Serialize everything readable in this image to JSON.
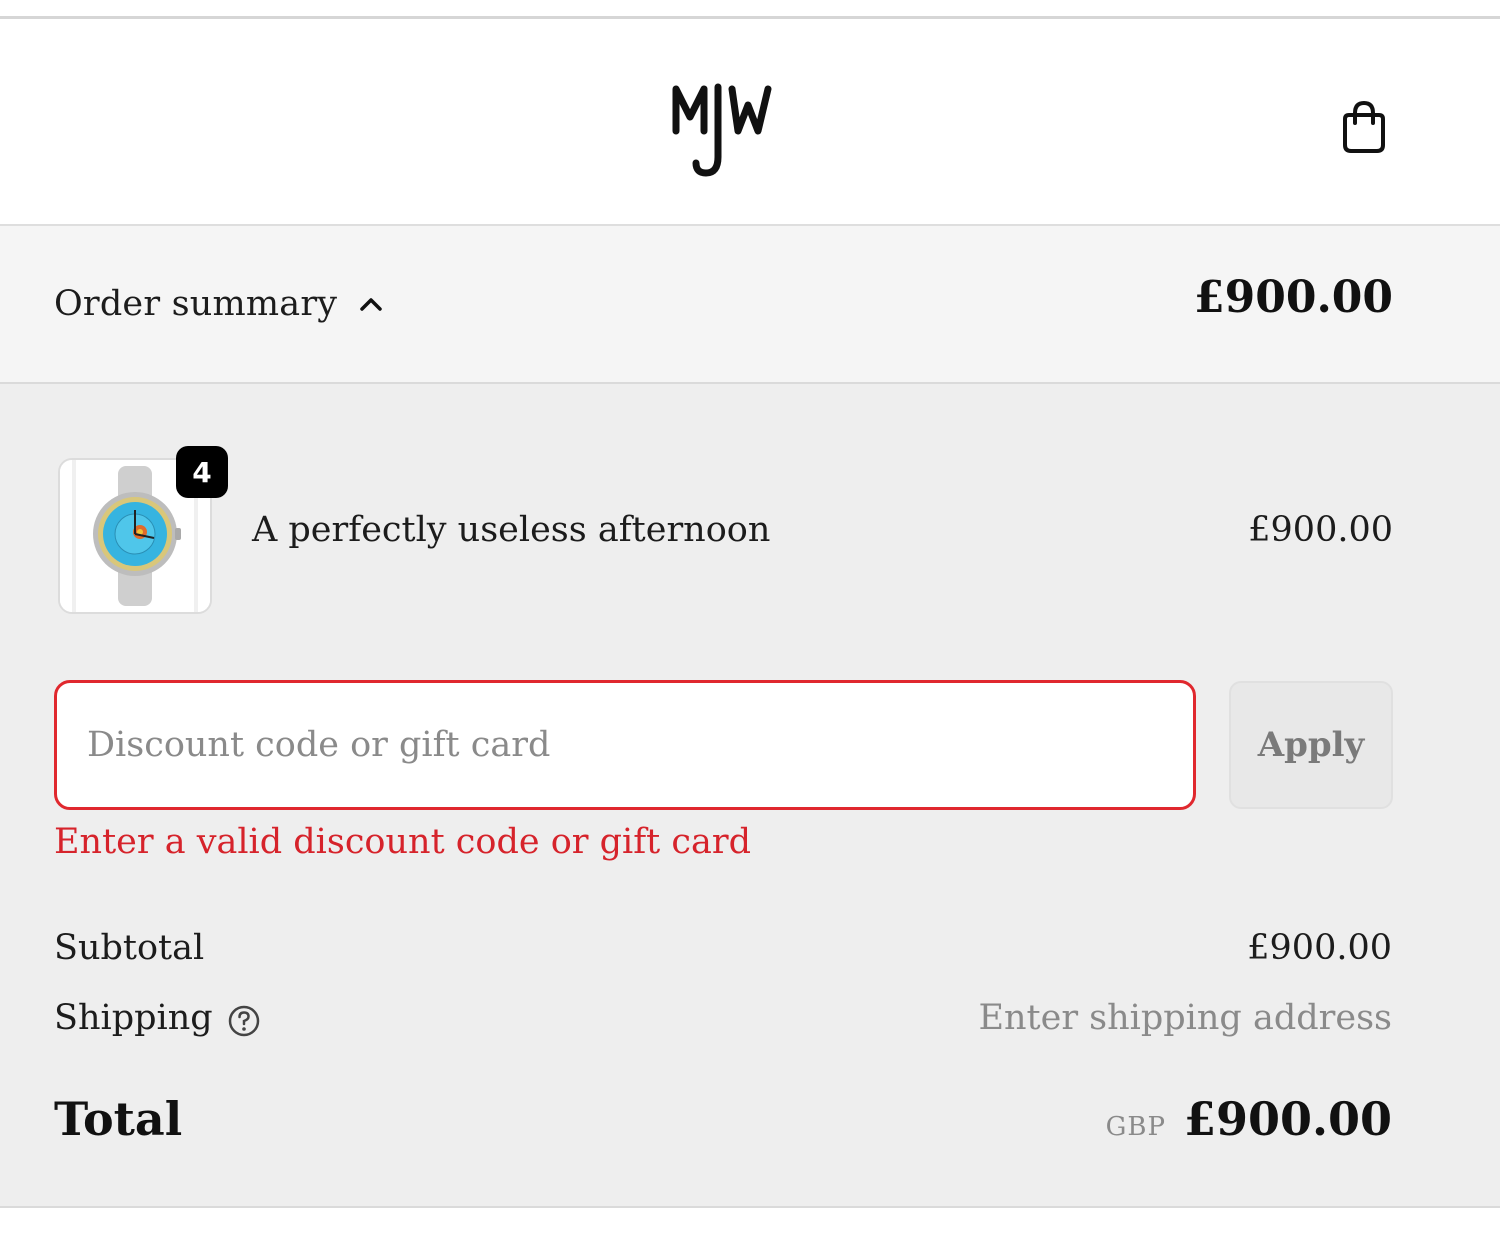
{
  "brand": {
    "logo_text": "MJW",
    "logo_icon": "mjw-monogram-logo"
  },
  "header": {
    "cart_icon": "shopping-bag-icon"
  },
  "summary": {
    "toggle_label": "Order summary",
    "toggle_icon": "chevron-up-icon",
    "total": "£900.00"
  },
  "items": [
    {
      "name": "A perfectly useless afternoon",
      "price": "£900.00",
      "quantity": "4",
      "image_icon": "watch-thumbnail"
    }
  ],
  "discount": {
    "placeholder": "Discount code or gift card",
    "value": "",
    "apply_label": "Apply",
    "error": "Enter a valid discount code or gift card"
  },
  "totals": {
    "subtotal_label": "Subtotal",
    "subtotal_value": "£900.00",
    "shipping_label": "Shipping",
    "shipping_help_icon": "question-circle-icon",
    "shipping_value": "Enter shipping address",
    "total_label": "Total",
    "currency": "GBP",
    "total_value": "£900.00"
  },
  "colors": {
    "error": "#d6232b",
    "summary_bar_bg": "#f5f5f5",
    "summary_body_bg": "#eeeeee",
    "badge_bg": "#000000"
  }
}
